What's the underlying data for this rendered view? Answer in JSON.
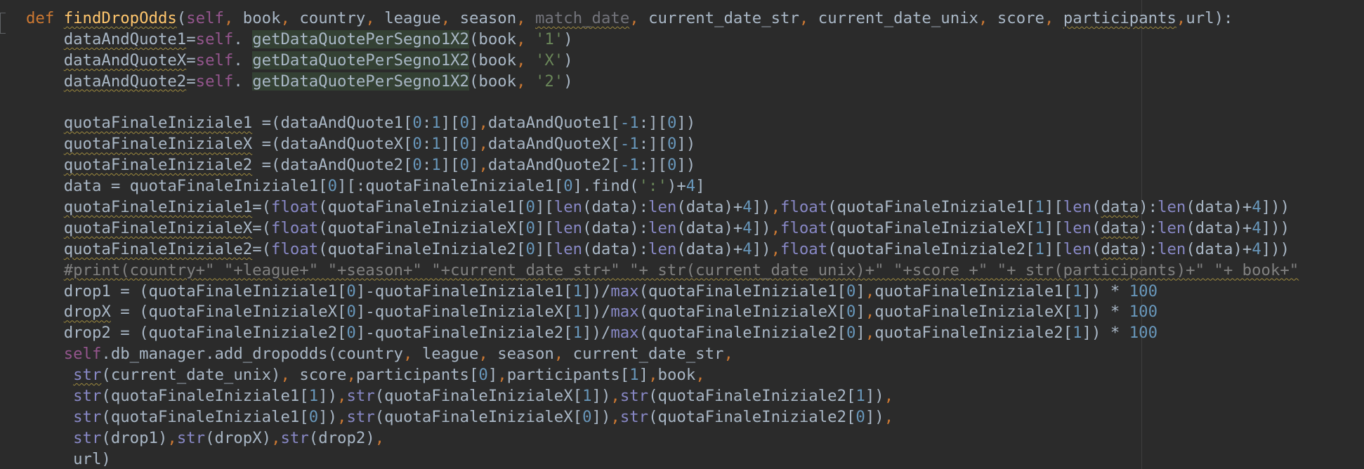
{
  "editor": {
    "language": "python",
    "theme_colors": {
      "background": "#2b2b2b",
      "default_text": "#a9b7c6",
      "keyword": "#cc7832",
      "function_name": "#ffc66d",
      "self": "#94558d",
      "builtin": "#8888c6",
      "number": "#6897bb",
      "string": "#6a8759",
      "comment": "#808080"
    },
    "lines": [
      [
        [
          "kw",
          "def "
        ],
        [
          "fn w",
          "findDropOdds"
        ],
        [
          "",
          "("
        ],
        [
          "slf",
          "self"
        ],
        [
          "kw",
          ", "
        ],
        [
          "",
          "book"
        ],
        [
          "kw",
          ", "
        ],
        [
          "",
          "country"
        ],
        [
          "kw",
          ", "
        ],
        [
          "",
          "league"
        ],
        [
          "kw",
          ", "
        ],
        [
          "",
          "season"
        ],
        [
          "kw",
          ", "
        ],
        [
          "unused w",
          "match_date"
        ],
        [
          "kw",
          ", "
        ],
        [
          "",
          "current_date_str"
        ],
        [
          "kw",
          ", "
        ],
        [
          "",
          "current_date_unix"
        ],
        [
          "kw",
          ", "
        ],
        [
          "",
          "score"
        ],
        [
          "kw",
          ", "
        ],
        [
          "w",
          "participants"
        ],
        [
          "kw",
          ","
        ],
        [
          "",
          "url):"
        ]
      ],
      [
        [
          "",
          "    "
        ],
        [
          "w",
          "dataAndQuote1"
        ],
        [
          "",
          "="
        ],
        [
          "slf",
          "self"
        ],
        [
          "",
          ". "
        ],
        [
          "hl",
          "getDataQuotePerSegno1X2"
        ],
        [
          "",
          "(book"
        ],
        [
          "kw",
          ","
        ],
        [
          "str",
          " '1'"
        ],
        [
          "",
          ")"
        ]
      ],
      [
        [
          "",
          "    "
        ],
        [
          "w",
          "dataAndQuoteX"
        ],
        [
          "",
          "="
        ],
        [
          "slf",
          "self"
        ],
        [
          "",
          ". "
        ],
        [
          "hl",
          "getDataQuotePerSegno1X2"
        ],
        [
          "",
          "(book"
        ],
        [
          "kw",
          ","
        ],
        [
          "str",
          " 'X'"
        ],
        [
          "",
          ")"
        ]
      ],
      [
        [
          "",
          "    "
        ],
        [
          "w",
          "dataAndQuote2"
        ],
        [
          "",
          "="
        ],
        [
          "slf",
          "self"
        ],
        [
          "",
          ". "
        ],
        [
          "hl",
          "getDataQuotePerSegno1X2"
        ],
        [
          "",
          "(book"
        ],
        [
          "kw",
          ","
        ],
        [
          "str",
          " '2'"
        ],
        [
          "",
          ")"
        ]
      ],
      [],
      [
        [
          "",
          "    "
        ],
        [
          "w",
          "quotaFinaleIniziale1"
        ],
        [
          "",
          " =(dataAndQuote1["
        ],
        [
          "num",
          "0"
        ],
        [
          "",
          ":"
        ],
        [
          "num",
          "1"
        ],
        [
          "",
          "]["
        ],
        [
          "num",
          "0"
        ],
        [
          "",
          "]"
        ],
        [
          "kw",
          ","
        ],
        [
          "",
          "dataAndQuote1["
        ],
        [
          "num",
          "-1"
        ],
        [
          "",
          ":]["
        ],
        [
          "num",
          "0"
        ],
        [
          "",
          "])"
        ]
      ],
      [
        [
          "",
          "    "
        ],
        [
          "w",
          "quotaFinaleInizialeX"
        ],
        [
          "",
          " =(dataAndQuoteX["
        ],
        [
          "num",
          "0"
        ],
        [
          "",
          ":"
        ],
        [
          "num",
          "1"
        ],
        [
          "",
          "]["
        ],
        [
          "num",
          "0"
        ],
        [
          "",
          "]"
        ],
        [
          "kw",
          ","
        ],
        [
          "",
          "dataAndQuoteX["
        ],
        [
          "num",
          "-1"
        ],
        [
          "",
          ":]["
        ],
        [
          "num",
          "0"
        ],
        [
          "",
          "])"
        ]
      ],
      [
        [
          "",
          "    "
        ],
        [
          "w",
          "quotaFinaleIniziale2"
        ],
        [
          "",
          " =(dataAndQuote2["
        ],
        [
          "num",
          "0"
        ],
        [
          "",
          ":"
        ],
        [
          "num",
          "1"
        ],
        [
          "",
          "]["
        ],
        [
          "num",
          "0"
        ],
        [
          "",
          "]"
        ],
        [
          "kw",
          ","
        ],
        [
          "",
          "dataAndQuote2["
        ],
        [
          "num",
          "-1"
        ],
        [
          "",
          ":]["
        ],
        [
          "num",
          "0"
        ],
        [
          "",
          "])"
        ]
      ],
      [
        [
          "",
          "    data = quotaFinaleIniziale1["
        ],
        [
          "num",
          "0"
        ],
        [
          "",
          "][:quotaFinaleIniziale1["
        ],
        [
          "num",
          "0"
        ],
        [
          "",
          "].find("
        ],
        [
          "str",
          "':'"
        ],
        [
          "",
          ")+"
        ],
        [
          "num",
          "4"
        ],
        [
          "",
          "]"
        ]
      ],
      [
        [
          "",
          "    "
        ],
        [
          "w",
          "quotaFinaleIniziale1"
        ],
        [
          "",
          "=("
        ],
        [
          "bi",
          "float"
        ],
        [
          "",
          "(quotaFinaleIniziale1["
        ],
        [
          "num",
          "0"
        ],
        [
          "",
          "]["
        ],
        [
          "bi",
          "len"
        ],
        [
          "",
          "(data):"
        ],
        [
          "bi",
          "len"
        ],
        [
          "",
          "(data)+"
        ],
        [
          "num",
          "4"
        ],
        [
          "",
          "])"
        ],
        [
          "kw",
          ","
        ],
        [
          "bi",
          "float"
        ],
        [
          "",
          "(quotaFinaleIniziale1["
        ],
        [
          "num",
          "1"
        ],
        [
          "",
          "]["
        ],
        [
          "bi",
          "len"
        ],
        [
          "",
          "("
        ],
        [
          "w",
          "data"
        ],
        [
          "",
          "):"
        ],
        [
          "bi",
          "len"
        ],
        [
          "",
          "(data)+"
        ],
        [
          "num",
          "4"
        ],
        [
          "",
          "]))"
        ]
      ],
      [
        [
          "",
          "    "
        ],
        [
          "w",
          "quotaFinaleInizialeX"
        ],
        [
          "",
          "=("
        ],
        [
          "bi",
          "float"
        ],
        [
          "",
          "(quotaFinaleInizialeX["
        ],
        [
          "num",
          "0"
        ],
        [
          "",
          "]["
        ],
        [
          "bi",
          "len"
        ],
        [
          "",
          "(data):"
        ],
        [
          "bi",
          "len"
        ],
        [
          "",
          "(data)+"
        ],
        [
          "num",
          "4"
        ],
        [
          "",
          "])"
        ],
        [
          "kw",
          ","
        ],
        [
          "bi",
          "float"
        ],
        [
          "",
          "(quotaFinaleInizialeX["
        ],
        [
          "num",
          "1"
        ],
        [
          "",
          "]["
        ],
        [
          "bi",
          "len"
        ],
        [
          "",
          "("
        ],
        [
          "w",
          "data"
        ],
        [
          "",
          "):"
        ],
        [
          "bi",
          "len"
        ],
        [
          "",
          "(data)+"
        ],
        [
          "num",
          "4"
        ],
        [
          "",
          "]))"
        ]
      ],
      [
        [
          "",
          "    "
        ],
        [
          "w",
          "quotaFinaleIniziale2"
        ],
        [
          "",
          "=("
        ],
        [
          "bi",
          "float"
        ],
        [
          "",
          "(quotaFinaleIniziale2["
        ],
        [
          "num",
          "0"
        ],
        [
          "",
          "]["
        ],
        [
          "bi",
          "len"
        ],
        [
          "",
          "(data):"
        ],
        [
          "bi",
          "len"
        ],
        [
          "",
          "(data)+"
        ],
        [
          "num",
          "4"
        ],
        [
          "",
          "])"
        ],
        [
          "kw",
          ","
        ],
        [
          "bi",
          "float"
        ],
        [
          "",
          "(quotaFinaleIniziale2["
        ],
        [
          "num",
          "1"
        ],
        [
          "",
          "]["
        ],
        [
          "bi",
          "len"
        ],
        [
          "",
          "("
        ],
        [
          "w",
          "data"
        ],
        [
          "",
          "):"
        ],
        [
          "bi",
          "len"
        ],
        [
          "",
          "(data)+"
        ],
        [
          "num",
          "4"
        ],
        [
          "",
          "]))"
        ]
      ],
      [
        [
          "",
          "    "
        ],
        [
          "cm w",
          "#print(country+\" \"+league+\" \"+season+\" \"+current_date_str+\" \"+ str(current_date_unix)+\" \"+score +\" \"+ str(participants)+\" \"+ book+\""
        ]
      ],
      [
        [
          "",
          "    drop1 = (quotaFinaleIniziale1["
        ],
        [
          "num",
          "0"
        ],
        [
          "",
          "]-quotaFinaleIniziale1["
        ],
        [
          "num",
          "1"
        ],
        [
          "",
          "])/"
        ],
        [
          "bi",
          "max"
        ],
        [
          "",
          "(quotaFinaleIniziale1["
        ],
        [
          "num",
          "0"
        ],
        [
          "",
          "]"
        ],
        [
          "kw",
          ","
        ],
        [
          "",
          "quotaFinaleIniziale1["
        ],
        [
          "num",
          "1"
        ],
        [
          "",
          "]) *"
        ],
        [
          "num",
          " 100"
        ]
      ],
      [
        [
          "",
          "    "
        ],
        [
          "w",
          "dropX"
        ],
        [
          "",
          " = (quotaFinaleInizialeX["
        ],
        [
          "num",
          "0"
        ],
        [
          "",
          "]-quotaFinaleInizialeX["
        ],
        [
          "num",
          "1"
        ],
        [
          "",
          "])/"
        ],
        [
          "bi",
          "max"
        ],
        [
          "",
          "(quotaFinaleInizialeX["
        ],
        [
          "num",
          "0"
        ],
        [
          "",
          "]"
        ],
        [
          "kw",
          ","
        ],
        [
          "",
          "quotaFinaleInizialeX["
        ],
        [
          "num",
          "1"
        ],
        [
          "",
          "]) *"
        ],
        [
          "num",
          " 100"
        ]
      ],
      [
        [
          "",
          "    drop2 = (quotaFinaleIniziale2["
        ],
        [
          "num",
          "0"
        ],
        [
          "",
          "]-quotaFinaleIniziale2["
        ],
        [
          "num",
          "1"
        ],
        [
          "",
          "])/"
        ],
        [
          "bi",
          "max"
        ],
        [
          "",
          "(quotaFinaleIniziale2["
        ],
        [
          "num",
          "0"
        ],
        [
          "",
          "]"
        ],
        [
          "kw",
          ","
        ],
        [
          "",
          "quotaFinaleIniziale2["
        ],
        [
          "num",
          "1"
        ],
        [
          "",
          "]) *"
        ],
        [
          "num",
          " 100"
        ]
      ],
      [
        [
          "",
          "    "
        ],
        [
          "slf",
          "self"
        ],
        [
          "",
          ".db_manager.add_dropodds(country"
        ],
        [
          "kw",
          ", "
        ],
        [
          "",
          "league"
        ],
        [
          "kw",
          ", "
        ],
        [
          "",
          "season"
        ],
        [
          "kw",
          ", "
        ],
        [
          "",
          "current_date_str"
        ],
        [
          "kw",
          ","
        ]
      ],
      [
        [
          "",
          "     "
        ],
        [
          "bi w",
          "str"
        ],
        [
          "",
          "(current_date_unix)"
        ],
        [
          "kw",
          ", "
        ],
        [
          "",
          "score"
        ],
        [
          "kw",
          ","
        ],
        [
          "",
          "participants["
        ],
        [
          "num",
          "0"
        ],
        [
          "",
          "]"
        ],
        [
          "kw",
          ","
        ],
        [
          "",
          "participants["
        ],
        [
          "num",
          "1"
        ],
        [
          "",
          "]"
        ],
        [
          "kw",
          ","
        ],
        [
          "",
          "book"
        ],
        [
          "kw",
          ","
        ]
      ],
      [
        [
          "",
          "     "
        ],
        [
          "bi",
          "str"
        ],
        [
          "",
          "(quotaFinaleIniziale1["
        ],
        [
          "num",
          "1"
        ],
        [
          "",
          "])"
        ],
        [
          "kw",
          ","
        ],
        [
          "bi",
          "str"
        ],
        [
          "",
          "(quotaFinaleInizialeX["
        ],
        [
          "num",
          "1"
        ],
        [
          "",
          "])"
        ],
        [
          "kw",
          ","
        ],
        [
          "bi",
          "str"
        ],
        [
          "",
          "(quotaFinaleIniziale2["
        ],
        [
          "num",
          "1"
        ],
        [
          "",
          "])"
        ],
        [
          "kw",
          ","
        ]
      ],
      [
        [
          "",
          "     "
        ],
        [
          "bi",
          "str"
        ],
        [
          "",
          "(quotaFinaleIniziale1["
        ],
        [
          "num",
          "0"
        ],
        [
          "",
          "])"
        ],
        [
          "kw",
          ","
        ],
        [
          "bi",
          "str"
        ],
        [
          "",
          "(quotaFinaleInizialeX["
        ],
        [
          "num",
          "0"
        ],
        [
          "",
          "])"
        ],
        [
          "kw",
          ","
        ],
        [
          "bi",
          "str"
        ],
        [
          "",
          "(quotaFinaleIniziale2["
        ],
        [
          "num",
          "0"
        ],
        [
          "",
          "])"
        ],
        [
          "kw",
          ","
        ]
      ],
      [
        [
          "",
          "     "
        ],
        [
          "bi",
          "str"
        ],
        [
          "",
          "(drop1)"
        ],
        [
          "kw",
          ","
        ],
        [
          "bi",
          "str"
        ],
        [
          "",
          "(dropX)"
        ],
        [
          "kw",
          ","
        ],
        [
          "bi",
          "str"
        ],
        [
          "",
          "(drop2)"
        ],
        [
          "kw",
          ","
        ]
      ],
      [
        [
          "",
          "     url)"
        ]
      ]
    ]
  }
}
